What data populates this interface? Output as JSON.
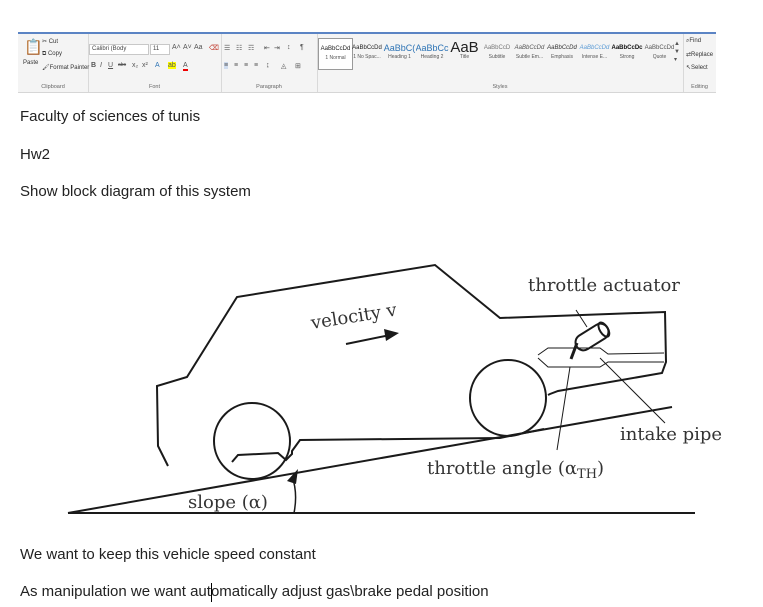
{
  "ribbon": {
    "clipboard": {
      "paste": "Paste",
      "cut": "Cut",
      "copy": "Copy",
      "format_painter": "Format Painter",
      "label": "Clipboard"
    },
    "font": {
      "name": "Calibri (Body",
      "size": "11",
      "label": "Font"
    },
    "paragraph": {
      "label": "Paragraph"
    },
    "styles": {
      "label": "Styles",
      "items": [
        {
          "sample": "AaBbCcDd",
          "name": "1 Normal",
          "color": "#222222"
        },
        {
          "sample": "AaBbCcDd",
          "name": "1 No Spac...",
          "color": "#222222"
        },
        {
          "sample": "AaBbC(",
          "name": "Heading 1",
          "color": "#2e74b5"
        },
        {
          "sample": "AaBbCcE",
          "name": "Heading 2",
          "color": "#2e74b5"
        },
        {
          "sample": "AaB",
          "name": "Title",
          "color": "#222222"
        },
        {
          "sample": "AaBbCcD",
          "name": "Subtitle",
          "color": "#777777"
        },
        {
          "sample": "AaBbCcDd",
          "name": "Subtle Em...",
          "color": "#555555"
        },
        {
          "sample": "AaBbCcDd",
          "name": "Emphasis",
          "color": "#333333"
        },
        {
          "sample": "AaBbCcDd",
          "name": "Intense E...",
          "color": "#5b9bd5"
        },
        {
          "sample": "AaBbCcDc",
          "name": "Strong",
          "color": "#111111"
        },
        {
          "sample": "AaBbCcDd",
          "name": "Quote",
          "color": "#555555"
        }
      ]
    },
    "editing": {
      "find": "Find",
      "replace": "Replace",
      "select": "Select",
      "label": "Editing"
    }
  },
  "document": {
    "lines": [
      "Faculty of sciences of tunis",
      "Hw2",
      "Show block diagram of this system",
      "We want to keep this vehicle speed constant",
      "As manipulation we want automatically adjust gas\\brake pedal position"
    ]
  },
  "figure": {
    "velocity_label": "velocity v",
    "throttle_actuator_label": "throttle actuator",
    "intake_pipe_label": "intake pipe",
    "throttle_angle_label": "throttle angle (α",
    "throttle_angle_sub": "TH",
    "throttle_angle_close": ")",
    "slope_label": "slope (α)"
  }
}
